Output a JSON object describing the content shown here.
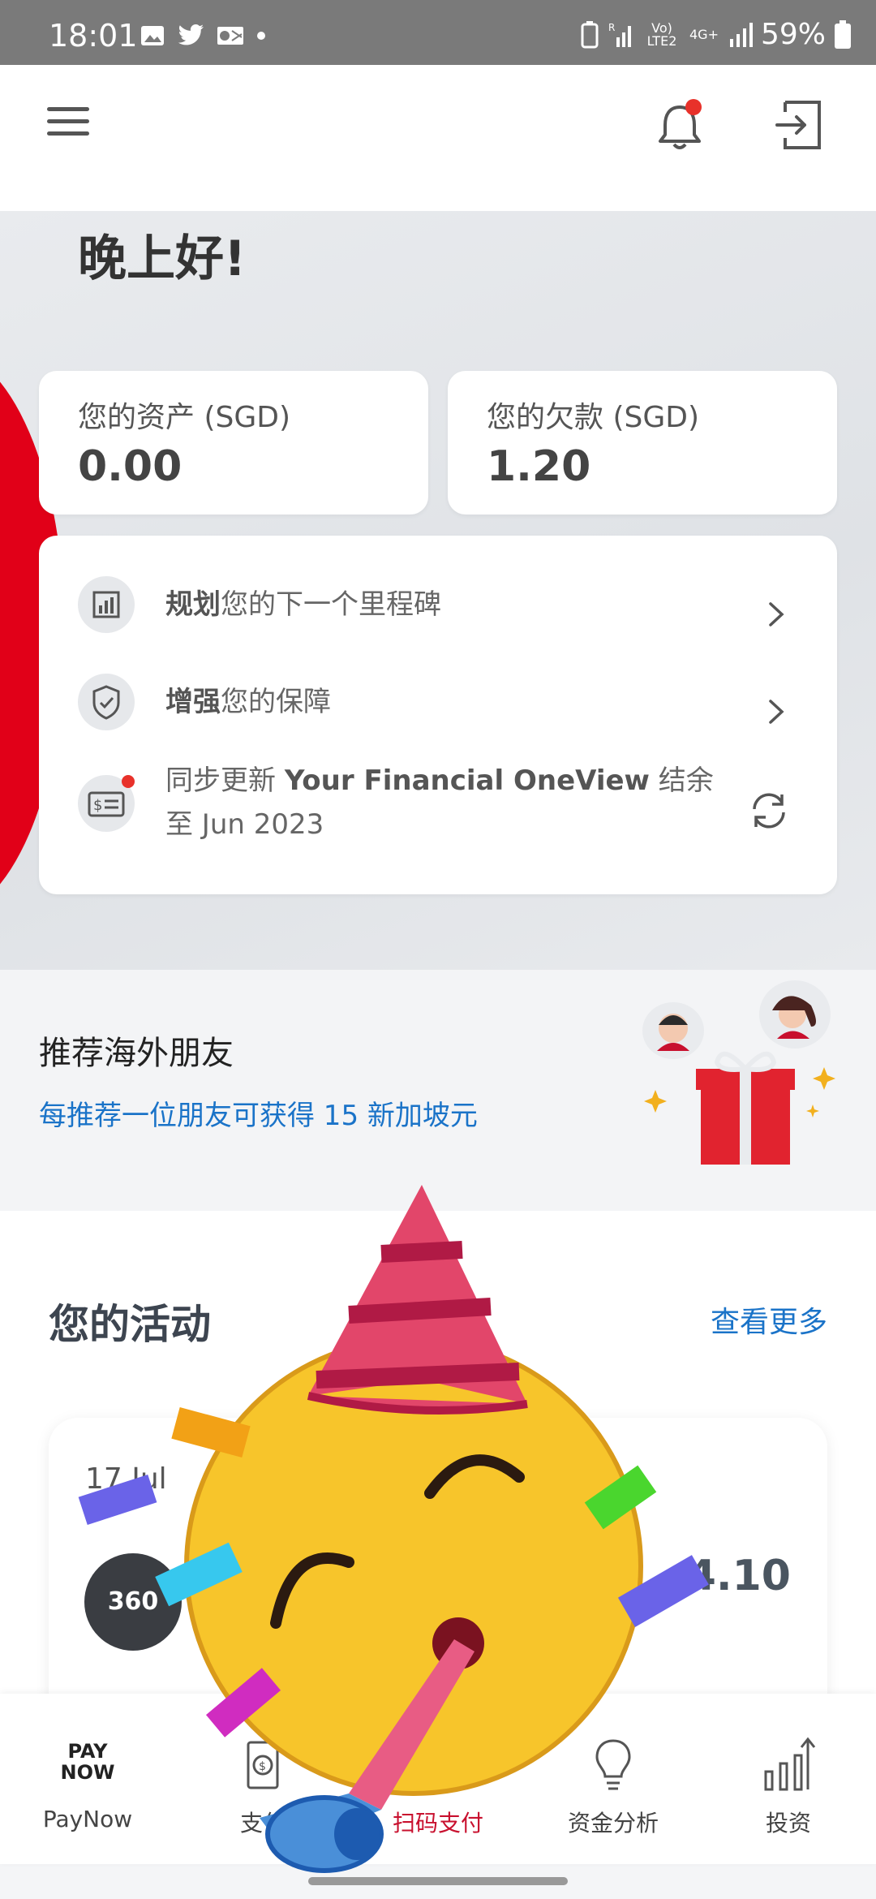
{
  "status_bar": {
    "time": "18:01",
    "battery": "59%",
    "volte": "Vo) LTE2",
    "network": "4G+"
  },
  "header": {
    "menu_icon": "menu-icon",
    "bell_icon": "bell-icon",
    "logout_icon": "logout-icon",
    "notification_color": "#e8312a"
  },
  "greeting": "晚上好!",
  "assets": {
    "label": "您的资产 (SGD)",
    "value": "0.00"
  },
  "debts": {
    "label": "您的欠款 (SGD)",
    "value": "1.20"
  },
  "actions": [
    {
      "bold": "规划",
      "text": "您的下一个里程碑",
      "icon": "chart-icon"
    },
    {
      "bold": "增强",
      "text": "您的保障",
      "icon": "shield-icon"
    },
    {
      "pre": "同步更新 ",
      "bold": "Your Financial OneView",
      "post": " 结余",
      "line2": "至 Jun 2023",
      "icon": "bill-icon"
    }
  ],
  "referral": {
    "title": "推荐海外朋友",
    "subtitle": "每推荐一位朋友可获得 15 新加坡元"
  },
  "activity": {
    "title": "您的活动",
    "see_more": "查看更多",
    "item": {
      "date": "17 Jul",
      "avatar_text": "360",
      "amount": "-4.10"
    }
  },
  "bottom_nav": [
    {
      "label": "PayNow",
      "icon": "paynow-icon",
      "logo_line1": "PAY",
      "logo_line2": "NOW"
    },
    {
      "label": "支付",
      "icon": "payment-icon"
    },
    {
      "label": "扫码支付",
      "icon": "scan-icon",
      "active": true
    },
    {
      "label": "资金分析",
      "icon": "bulb-icon"
    },
    {
      "label": "投资",
      "icon": "invest-icon"
    }
  ],
  "colors": {
    "brand_red": "#e10018",
    "link_blue": "#1a73c8"
  }
}
